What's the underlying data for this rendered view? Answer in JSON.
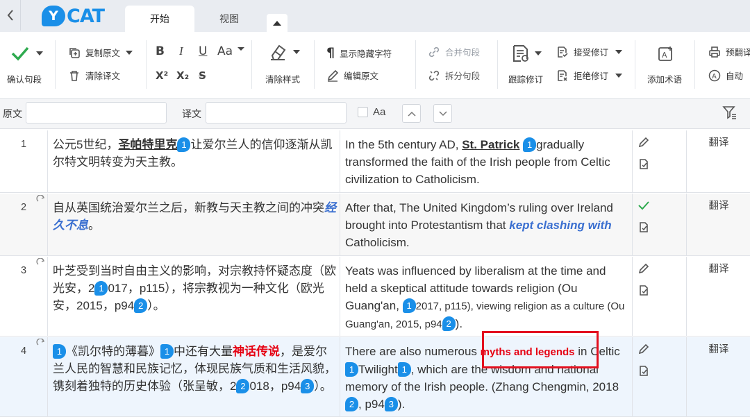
{
  "app": {
    "logo_badge": "Y",
    "logo_text": "CAT"
  },
  "tabs": [
    {
      "label": "开始"
    },
    {
      "label": "视图"
    }
  ],
  "ribbon": {
    "confirm": "确认句段",
    "copy_source": "复制原文",
    "clear_translation": "清除译文",
    "bold": "B",
    "italic": "I",
    "underline": "U",
    "case": "Aa",
    "superscript": "X²",
    "subscript": "X₂",
    "strikethrough": "S",
    "clear_format": "清除样式",
    "show_hidden": "显示隐藏字符",
    "edit_source": "编辑原文",
    "merge": "合并句段",
    "split": "拆分句段",
    "track_changes": "跟踪修订",
    "accept_changes": "接受修订",
    "reject_changes": "拒绝修订",
    "add_term": "添加术语",
    "pretranslate": "预翻译",
    "auto": "自动"
  },
  "filter": {
    "source_label": "原文",
    "target_label": "译文",
    "case_label": "Aa",
    "source_value": "",
    "target_value": ""
  },
  "segments": [
    {
      "num": "1",
      "src_a": "公元5世纪，",
      "src_term": "圣帕特里克",
      "src_tag": "1",
      "src_b": "让爱尔兰人的信仰逐渐从凯尔特文明转变为天主教。",
      "tgt_a": "In the 5th century AD, ",
      "tgt_term": "St. Patrick",
      "tgt_tag": "1",
      "tgt_b": "gradually transformed the faith of the Irish people from Celtic civilization to Catholicism.",
      "status": "翻译"
    },
    {
      "num": "2",
      "src_a": "自从英国统治爱尔兰之后，新教与天主教之间的冲突",
      "src_em": "经久不息",
      "src_b": "。",
      "tgt_a": "After that, The United Kingdom’s ruling over Ireland brought into Protestantism that ",
      "tgt_em": "kept clashing with",
      "tgt_b": " Catholicism.",
      "status": "翻译"
    },
    {
      "num": "3",
      "src_a": "叶芝受到当时自由主义的影响，对宗教持怀疑态度（欧光安，2",
      "src_tag1": "1",
      "src_b": "017，p115），将宗教视为一种文化（欧光安，2015，p94",
      "src_tag2": "2",
      "src_c": "）。",
      "tgt_a": "Yeats was influenced by liberalism at the time and held a skeptical attitude towards religion (Ou Guang'an, ",
      "tgt_tag1": "1",
      "tgt_b": "2017, p115), viewing religion as a culture (Ou Guang'an, 2015, p94",
      "tgt_tag2": "2",
      "tgt_c": ").",
      "status": "翻译"
    },
    {
      "num": "4",
      "src_tag1": "1",
      "src_a": "《凯尔特的薄暮》",
      "src_tag2": "1",
      "src_b": "中还有大量",
      "src_em": "神话传说",
      "src_c": "，是爱尔兰人民的智慧和民族记忆，体现民族气质和生活风貌，镌刻着独特的历史体验（张呈敏，2",
      "src_tag3": "2",
      "src_d": "018，p94",
      "src_tag4": "3",
      "src_e": "）。",
      "tgt_a": "There are also numerous ",
      "tgt_em": "myths and legends",
      "tgt_b": " in Celtic ",
      "tgt_tag1": "1",
      "tgt_c": "Twilight",
      "tgt_tag2": "1",
      "tgt_d": ", which are the wisdom and national memory of the Irish people. (Zhang Chengmin, 2018",
      "tgt_tag3": "2",
      "tgt_e": ", p94",
      "tgt_tag4": "3",
      "tgt_f": ").",
      "status": "翻译"
    }
  ],
  "colors": {
    "accent": "#1a8fe8",
    "confirm_green": "#2eaa4f",
    "highlight_red": "#e3101f",
    "emphasis_blue": "#3a6fd0"
  }
}
